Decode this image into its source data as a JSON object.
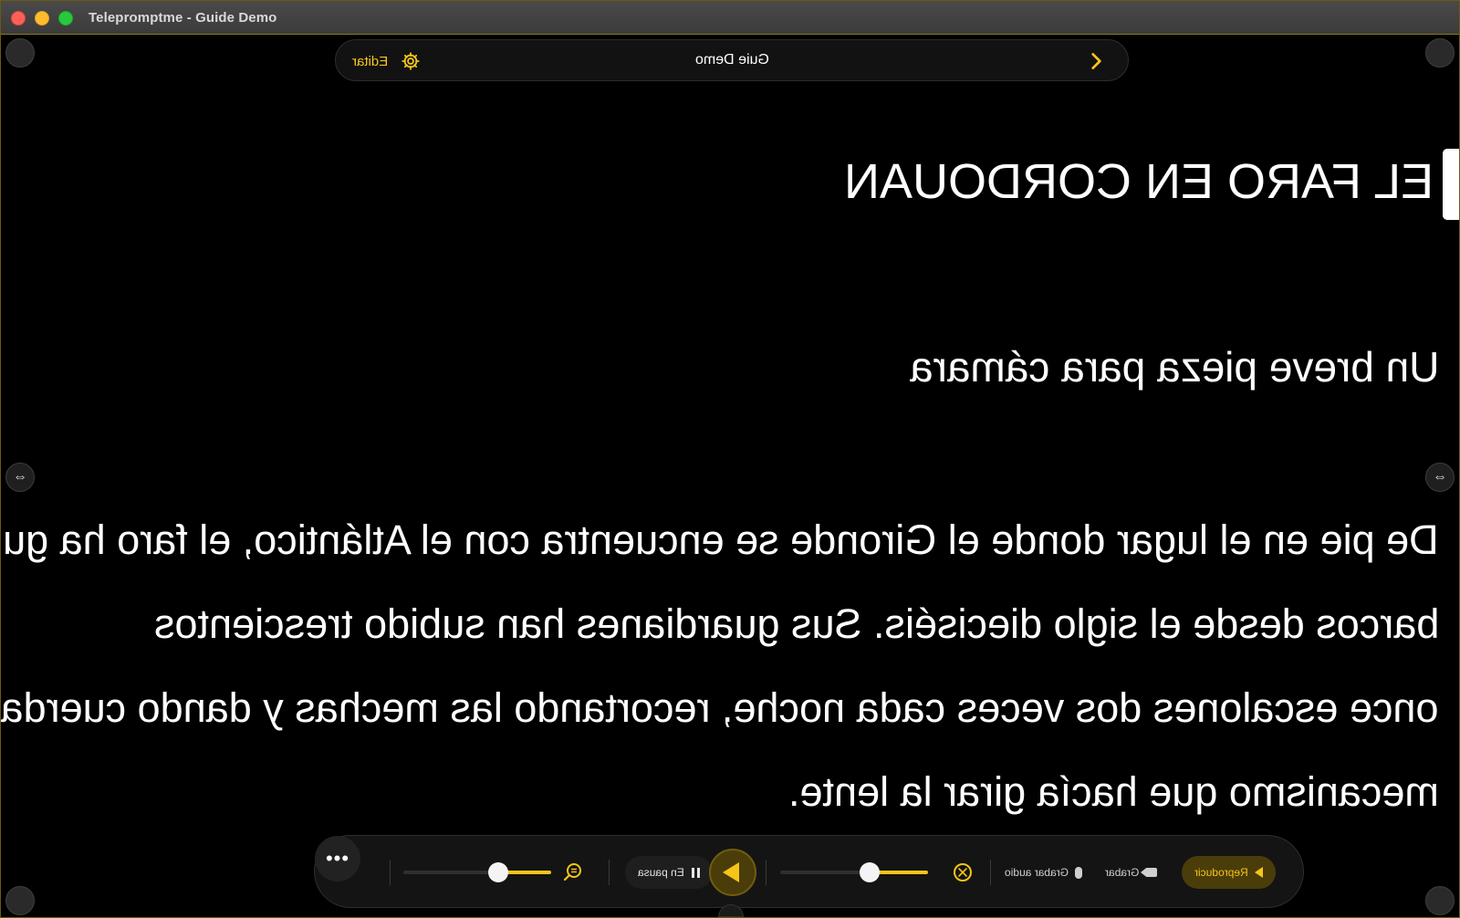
{
  "window": {
    "title": "Telepromptme - Guide Demo"
  },
  "header": {
    "edit_label": "Editar",
    "script_title": "Guie Demo",
    "icons": [
      "gear-icon",
      "chevron-right-icon"
    ]
  },
  "script": {
    "title": "EL FARO EN CORDOUAN",
    "subtitle": "Un breve pieza para cámara",
    "lines": [
      "De pie en el lugar donde el Gironde se encuentra con el Atlántico, el faro ha guiado",
      "barcos desde el siglo dieciséis. Sus guardianes han subido trescientos",
      "once escalones dos veces cada noche, recortando las mechas y dando cuerda al",
      "mecanismo que hacía girar la lente."
    ],
    "mirrored": true
  },
  "controls": {
    "more_label": "•••",
    "font_size_level": 0.45,
    "speed_level": 0.35,
    "paused_label": "En pausa",
    "modes": {
      "play_label": "Reproducir",
      "record_label": "Grabar",
      "record_audio_label": "Grabar audio"
    },
    "icons": [
      "zoom-icon",
      "pause-icon",
      "play-icon",
      "speed-icon",
      "camera-icon",
      "mic-icon"
    ]
  },
  "colors": {
    "accent": "#f5c518",
    "background": "#000000",
    "text": "#ffffff"
  }
}
